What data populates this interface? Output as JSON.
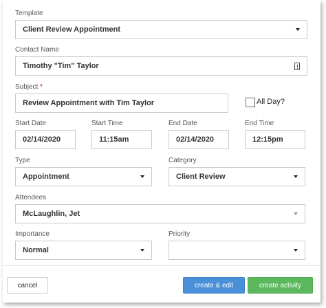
{
  "form": {
    "template": {
      "label": "Template",
      "value": "Client Review Appointment"
    },
    "contact": {
      "label": "Contact Name",
      "value": "Timothy \"Tim\"  Taylor"
    },
    "subject": {
      "label": "Subject",
      "required_mark": "*",
      "value": "Review Appointment with Tim Taylor"
    },
    "all_day": {
      "label": "All Day?",
      "checked": false
    },
    "start_date": {
      "label": "Start Date",
      "value": "02/14/2020"
    },
    "start_time": {
      "label": "Start Time",
      "value": "11:15am"
    },
    "end_date": {
      "label": "End Date",
      "value": "02/14/2020"
    },
    "end_time": {
      "label": "End Time",
      "value": "12:15pm"
    },
    "type": {
      "label": "Type",
      "value": "Appointment"
    },
    "category": {
      "label": "Category",
      "value": "Client Review"
    },
    "attendees": {
      "label": "Attendees",
      "value": "McLaughlin, Jet"
    },
    "importance": {
      "label": "Importance",
      "value": "Normal"
    },
    "priority": {
      "label": "Priority",
      "value": ""
    }
  },
  "actions": {
    "cancel": "cancel",
    "create_edit": "create & edit",
    "create_activity": "create activity"
  },
  "icons": {
    "dropdown": "chevron-down-icon",
    "contact_card": "contact-card-icon"
  },
  "colors": {
    "required": "#d0021b",
    "primary": "#4a90d9",
    "success": "#5cb85c"
  }
}
